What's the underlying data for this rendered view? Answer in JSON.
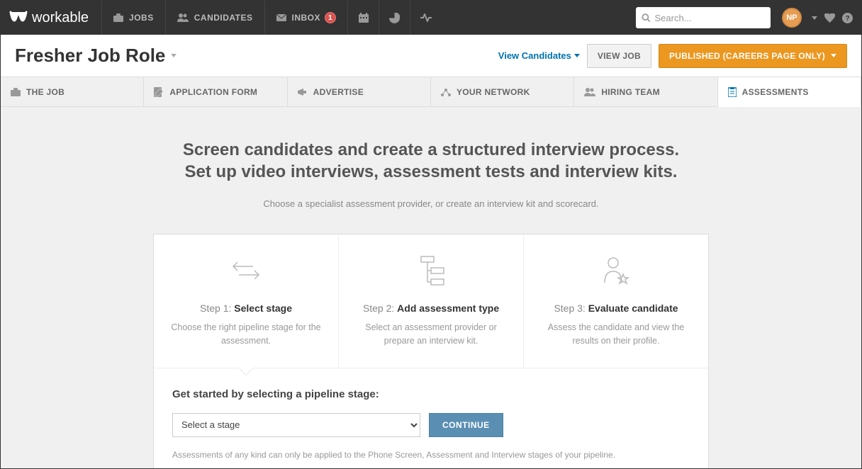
{
  "brand": "workable",
  "nav": {
    "jobs": "JOBS",
    "candidates": "CANDIDATES",
    "inbox": "INBOX",
    "inbox_badge": "1"
  },
  "search": {
    "placeholder": "Search..."
  },
  "user": {
    "initials": "NP"
  },
  "job": {
    "title": "Fresher Job Role",
    "view_candidates": "View Candidates",
    "view_job": "VIEW JOB",
    "status": "PUBLISHED (CAREERS PAGE ONLY)"
  },
  "tabs": {
    "the_job": "THE JOB",
    "application_form": "APPLICATION FORM",
    "advertise": "ADVERTISE",
    "your_network": "YOUR NETWORK",
    "hiring_team": "HIRING TEAM",
    "assessments": "ASSESSMENTS"
  },
  "hero": {
    "line1": "Screen candidates and create a structured interview process.",
    "line2": "Set up video interviews, assessment tests and interview kits.",
    "sub": "Choose a specialist assessment provider, or create an interview kit and scorecard."
  },
  "steps": [
    {
      "prefix": "Step 1: ",
      "title": "Select stage",
      "desc": "Choose the right pipeline stage for the assessment."
    },
    {
      "prefix": "Step 2: ",
      "title": "Add assessment type",
      "desc": "Select an assessment provider or prepare an interview kit."
    },
    {
      "prefix": "Step 3: ",
      "title": "Evaluate candidate",
      "desc": "Assess the candidate and view the results on their profile."
    }
  ],
  "form": {
    "label": "Get started by selecting a pipeline stage:",
    "select_placeholder": "Select a stage",
    "continue": "CONTINUE",
    "note": "Assessments of any kind can only be applied to the Phone Screen, Assessment and Interview stages of your pipeline."
  }
}
